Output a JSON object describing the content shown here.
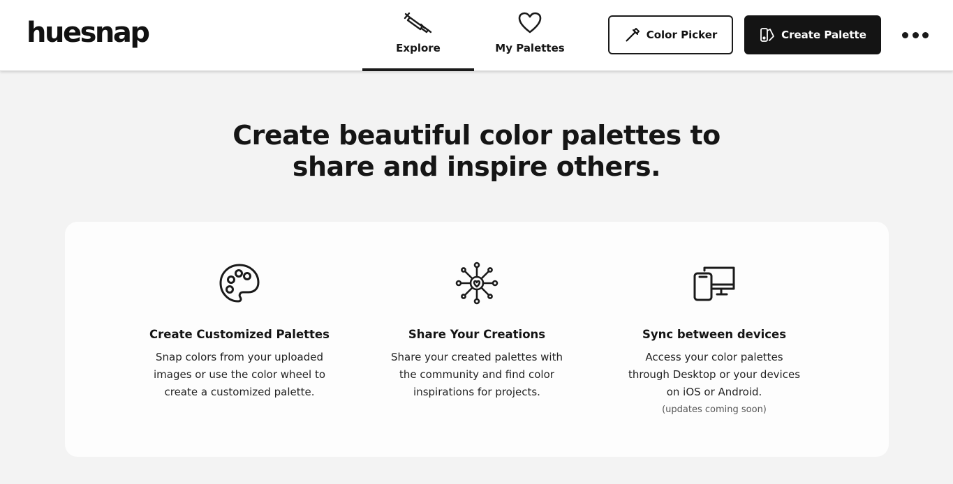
{
  "app": {
    "logo": "huesnap"
  },
  "nav": {
    "tabs": [
      {
        "label": "Explore",
        "icon": "dropper-explore-icon",
        "active": true
      },
      {
        "label": "My Palettes",
        "icon": "heart-icon",
        "active": false
      }
    ]
  },
  "toolbar": {
    "color_picker_label": "Color Picker",
    "create_palette_label": "Create Palette"
  },
  "hero": {
    "title_line1": "Create beautiful color palettes to",
    "title_line2": "share and inspire others."
  },
  "features": [
    {
      "icon": "palette-icon",
      "title": "Create Customized Palettes",
      "desc_lines": [
        "Snap colors from your uploaded",
        "images or use the color wheel to",
        "create a customized palette."
      ]
    },
    {
      "icon": "share-network-icon",
      "title": "Share Your Creations",
      "desc_lines": [
        "Share your created palettes with",
        "the community and find color",
        "inspirations for projects."
      ]
    },
    {
      "icon": "devices-icon",
      "title": "Sync between devices",
      "desc_lines": [
        "Access your color palettes",
        "through Desktop or your devices",
        "on iOS or Android."
      ],
      "note": "(updates coming soon)"
    }
  ],
  "colors": {
    "primary_dark": "#141414",
    "background": "#f3f3f3",
    "card": "#fdfdfd"
  }
}
